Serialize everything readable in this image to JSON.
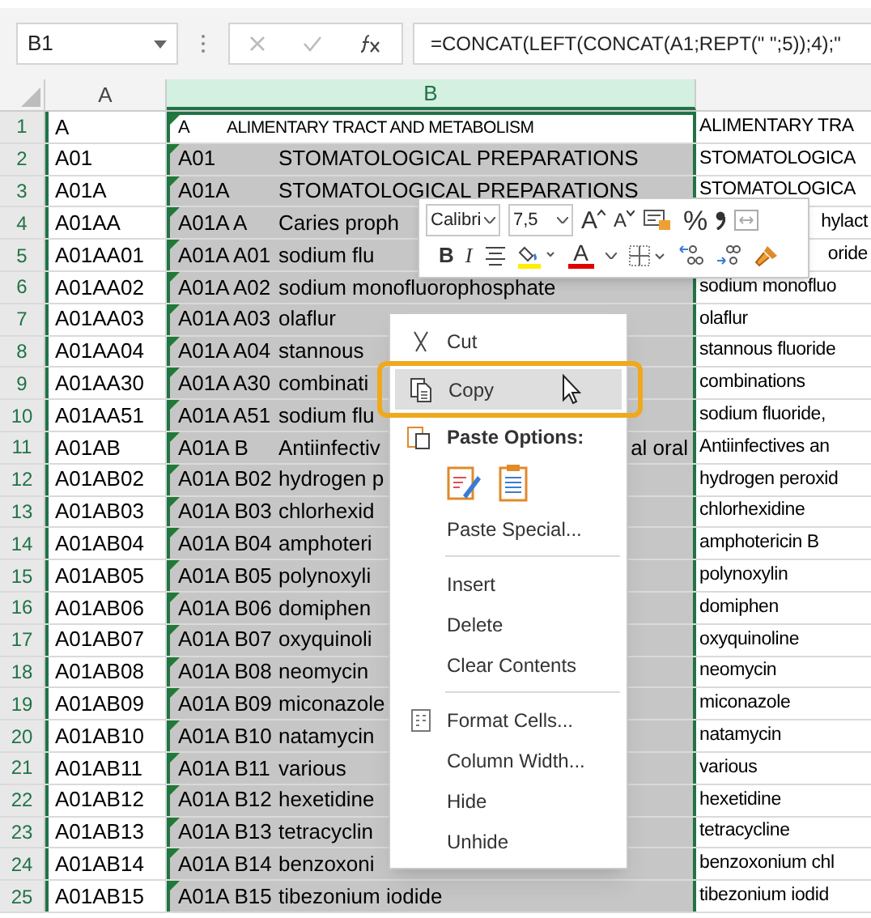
{
  "formula_bar": {
    "name_box": "B1",
    "formula": "=CONCAT(LEFT(CONCAT(A1;REPT(\" \";5));4);\""
  },
  "columns": [
    {
      "label": "A",
      "selected": false
    },
    {
      "label": "B",
      "selected": true
    }
  ],
  "rows": [
    {
      "number": "1",
      "a": "A",
      "b": {
        "kind": "caps",
        "code": "A",
        "text": "ALIMENTARY TRACT AND METABOLISM",
        "selected": false
      },
      "c": {
        "kind": "text",
        "text": "ALIMENTARY TRA"
      }
    },
    {
      "number": "2",
      "a": "A01",
      "b": {
        "kind": "plain",
        "code": "A01",
        "text": "STOMATOLOGICAL PREPARATIONS",
        "selected": true
      },
      "c": {
        "kind": "text",
        "text": "STOMATOLOGICA"
      }
    },
    {
      "number": "3",
      "a": "A01A",
      "b": {
        "kind": "plain",
        "code": "A01A",
        "text": "STOMATOLOGICAL PREPARATIONS",
        "selected": true
      },
      "c": {
        "kind": "text",
        "text": "STOMATOLOGICA"
      }
    },
    {
      "number": "4",
      "a": "A01AA",
      "b": {
        "kind": "plain",
        "code": "A01A A",
        "text": "Caries proph",
        "selected": true
      },
      "c": {
        "kind": "fragment",
        "text": "hylact"
      }
    },
    {
      "number": "5",
      "a": "A01AA01",
      "b": {
        "kind": "plain",
        "code": "A01A A01",
        "text": "sodium flu",
        "selected": true
      },
      "c": {
        "kind": "fragment",
        "text": "oride"
      }
    },
    {
      "number": "6",
      "a": "A01AA02",
      "b": {
        "kind": "plain",
        "code": "A01A A02",
        "text": "sodium monofluorophosphate",
        "selected": true
      },
      "c": {
        "kind": "text",
        "text": "sodium monofluo"
      }
    },
    {
      "number": "7",
      "a": "A01AA03",
      "b": {
        "kind": "plain",
        "code": "A01A A03",
        "text": "olaflur",
        "selected": true
      },
      "c": {
        "kind": "text",
        "text": "olaflur"
      }
    },
    {
      "number": "8",
      "a": "A01AA04",
      "b": {
        "kind": "plain",
        "code": "A01A A04",
        "text": "stannous",
        "selected": true
      },
      "c": {
        "kind": "text",
        "text": "stannous fluoride"
      }
    },
    {
      "number": "9",
      "a": "A01AA30",
      "b": {
        "kind": "plain",
        "code": "A01A A30",
        "text": "combinati",
        "selected": true
      },
      "c": {
        "kind": "text",
        "text": "combinations"
      }
    },
    {
      "number": "10",
      "a": "A01AA51",
      "b": {
        "kind": "plain",
        "code": "A01A A51",
        "text": "sodium flu",
        "selected": true
      },
      "c": {
        "kind": "text",
        "text": "sodium fluoride,"
      }
    },
    {
      "number": "11",
      "a": "A01AB",
      "b": {
        "kind": "plain",
        "code": "A01A B",
        "text": "Antiinfectiv",
        "tail": "al oral",
        "selected": true
      },
      "c": {
        "kind": "text",
        "text": "Antiinfectives an"
      }
    },
    {
      "number": "12",
      "a": "A01AB02",
      "b": {
        "kind": "plain",
        "code": "A01A B02",
        "text": "hydrogen p",
        "selected": true
      },
      "c": {
        "kind": "text",
        "text": "hydrogen peroxid"
      }
    },
    {
      "number": "13",
      "a": "A01AB03",
      "b": {
        "kind": "plain",
        "code": "A01A B03",
        "text": "chlorhexid",
        "selected": true
      },
      "c": {
        "kind": "text",
        "text": "chlorhexidine"
      }
    },
    {
      "number": "14",
      "a": "A01AB04",
      "b": {
        "kind": "plain",
        "code": "A01A B04",
        "text": "amphoteri",
        "selected": true
      },
      "c": {
        "kind": "text",
        "text": "amphotericin B"
      }
    },
    {
      "number": "15",
      "a": "A01AB05",
      "b": {
        "kind": "plain",
        "code": "A01A B05",
        "text": "polynoxyli",
        "selected": true
      },
      "c": {
        "kind": "text",
        "text": "polynoxylin"
      }
    },
    {
      "number": "16",
      "a": "A01AB06",
      "b": {
        "kind": "plain",
        "code": "A01A B06",
        "text": "domiphen",
        "selected": true
      },
      "c": {
        "kind": "text",
        "text": "domiphen"
      }
    },
    {
      "number": "17",
      "a": "A01AB07",
      "b": {
        "kind": "plain",
        "code": "A01A B07",
        "text": "oxyquinoli",
        "selected": true
      },
      "c": {
        "kind": "text",
        "text": "oxyquinoline"
      }
    },
    {
      "number": "18",
      "a": "A01AB08",
      "b": {
        "kind": "plain",
        "code": "A01A B08",
        "text": "neomycin",
        "selected": true
      },
      "c": {
        "kind": "text",
        "text": "neomycin"
      }
    },
    {
      "number": "19",
      "a": "A01AB09",
      "b": {
        "kind": "plain",
        "code": "A01A B09",
        "text": "miconazole",
        "selected": true
      },
      "c": {
        "kind": "text",
        "text": "miconazole"
      }
    },
    {
      "number": "20",
      "a": "A01AB10",
      "b": {
        "kind": "plain",
        "code": "A01A B10",
        "text": "natamycin",
        "selected": true
      },
      "c": {
        "kind": "text",
        "text": "natamycin"
      }
    },
    {
      "number": "21",
      "a": "A01AB11",
      "b": {
        "kind": "plain",
        "code": "A01A B11",
        "text": "various",
        "selected": true
      },
      "c": {
        "kind": "text",
        "text": "various"
      }
    },
    {
      "number": "22",
      "a": "A01AB12",
      "b": {
        "kind": "plain",
        "code": "A01A B12",
        "text": "hexetidine",
        "selected": true
      },
      "c": {
        "kind": "text",
        "text": "hexetidine"
      }
    },
    {
      "number": "23",
      "a": "A01AB13",
      "b": {
        "kind": "plain",
        "code": "A01A B13",
        "text": "tetracyclin",
        "selected": true
      },
      "c": {
        "kind": "text",
        "text": "tetracycline"
      }
    },
    {
      "number": "24",
      "a": "A01AB14",
      "b": {
        "kind": "plain",
        "code": "A01A B14",
        "text": "benzoxoni",
        "selected": true
      },
      "c": {
        "kind": "text",
        "text": "benzoxonium chl"
      }
    },
    {
      "number": "25",
      "a": "A01AB15",
      "b": {
        "kind": "plain",
        "code": "A01A B15",
        "text": "tibezonium iodide",
        "selected": true
      },
      "c": {
        "kind": "text",
        "text": "tibezonium iodid"
      }
    }
  ],
  "mini_toolbar": {
    "font": "Calibri",
    "size": "7,5",
    "grow_font": "A",
    "shrink_font": "A",
    "percent": "%",
    "bold": "B",
    "italic": "I",
    "font_color": "A"
  },
  "context_menu": [
    {
      "kind": "item",
      "label": "Cut",
      "selected": false
    },
    {
      "kind": "item",
      "label": "Copy",
      "selected": true
    },
    {
      "kind": "header",
      "label": "Paste Options:"
    },
    {
      "kind": "paste_icons"
    },
    {
      "kind": "item",
      "label": "Paste Special...",
      "selected": false
    },
    {
      "kind": "separator"
    },
    {
      "kind": "item",
      "label": "Insert",
      "selected": false
    },
    {
      "kind": "item",
      "label": "Delete",
      "selected": false
    },
    {
      "kind": "item",
      "label": "Clear Contents",
      "selected": false
    },
    {
      "kind": "separator"
    },
    {
      "kind": "item",
      "label": "Format Cells...",
      "selected": false
    },
    {
      "kind": "item",
      "label": "Column Width...",
      "selected": false
    },
    {
      "kind": "item",
      "label": "Hide",
      "selected": false
    },
    {
      "kind": "item",
      "label": "Unhide",
      "selected": false
    }
  ]
}
